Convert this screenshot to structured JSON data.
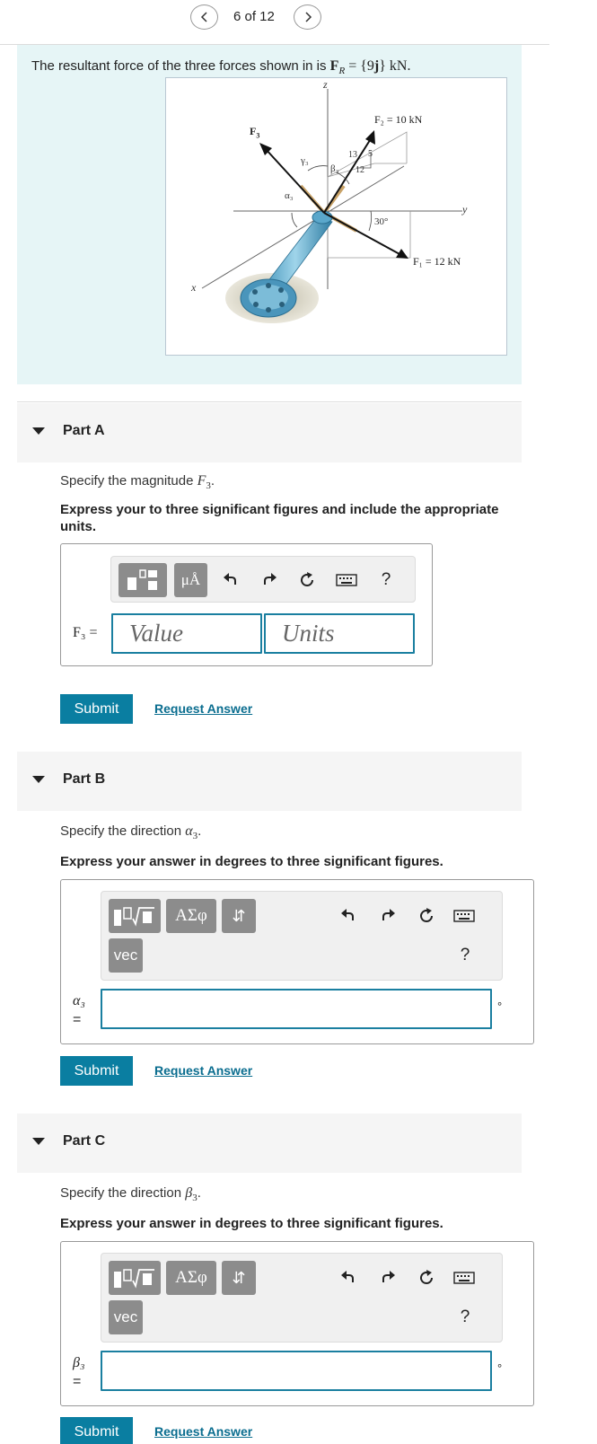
{
  "nav": {
    "counter": "6 of 12"
  },
  "problem": {
    "text_before": "The resultant force of the three forces shown in is ",
    "formula": "F",
    "formula_sub": "R",
    "formula_eq": " = {9",
    "formula_j": "j",
    "formula_end": "} kN.",
    "figure": {
      "label_z": "z",
      "label_x": "x",
      "label_y": "y",
      "label_F3": "F",
      "label_F3_sub": "3",
      "label_F2": "F₂ = 10 kN",
      "label_F1": "F₁ = 12 kN",
      "label_gamma3": "γ₃",
      "label_beta3": "β₃",
      "label_alpha3": "α₃",
      "label_13": "13",
      "label_5": "5",
      "label_12": "12",
      "label_30": "30°"
    }
  },
  "parts": [
    {
      "label": "Part A",
      "prompt": "Specify the magnitude ",
      "prompt_var": "F",
      "prompt_sub": "3",
      "prompt_end": ".",
      "instruction": "Express your to three significant figures and include the appropriate units.",
      "var_label": "F₃ =",
      "toolbar": {
        "mu_label": "μÅ",
        "help": "?"
      },
      "value_placeholder": "Value",
      "units_placeholder": "Units",
      "submit": "Submit",
      "request": "Request Answer"
    },
    {
      "label": "Part B",
      "prompt": "Specify the direction ",
      "prompt_var": "α",
      "prompt_sub": "3",
      "prompt_end": ".",
      "instruction": "Express your answer in degrees to three significant figures.",
      "var_label_top": "α₃",
      "var_label_bottom": "=",
      "toolbar": {
        "greek": "ΑΣφ",
        "swap": "⇵",
        "vec": "vec",
        "help": "?"
      },
      "unit_suffix": "°",
      "submit": "Submit",
      "request": "Request Answer"
    },
    {
      "label": "Part C",
      "prompt": "Specify the direction ",
      "prompt_var": "β",
      "prompt_sub": "3",
      "prompt_end": ".",
      "instruction": "Express your answer in degrees to three significant figures.",
      "var_label_top": "β₃",
      "var_label_bottom": "=",
      "toolbar": {
        "greek": "ΑΣφ",
        "swap": "⇵",
        "vec": "vec",
        "help": "?"
      },
      "unit_suffix": "°",
      "submit": "Submit",
      "request": "Request Answer"
    }
  ]
}
